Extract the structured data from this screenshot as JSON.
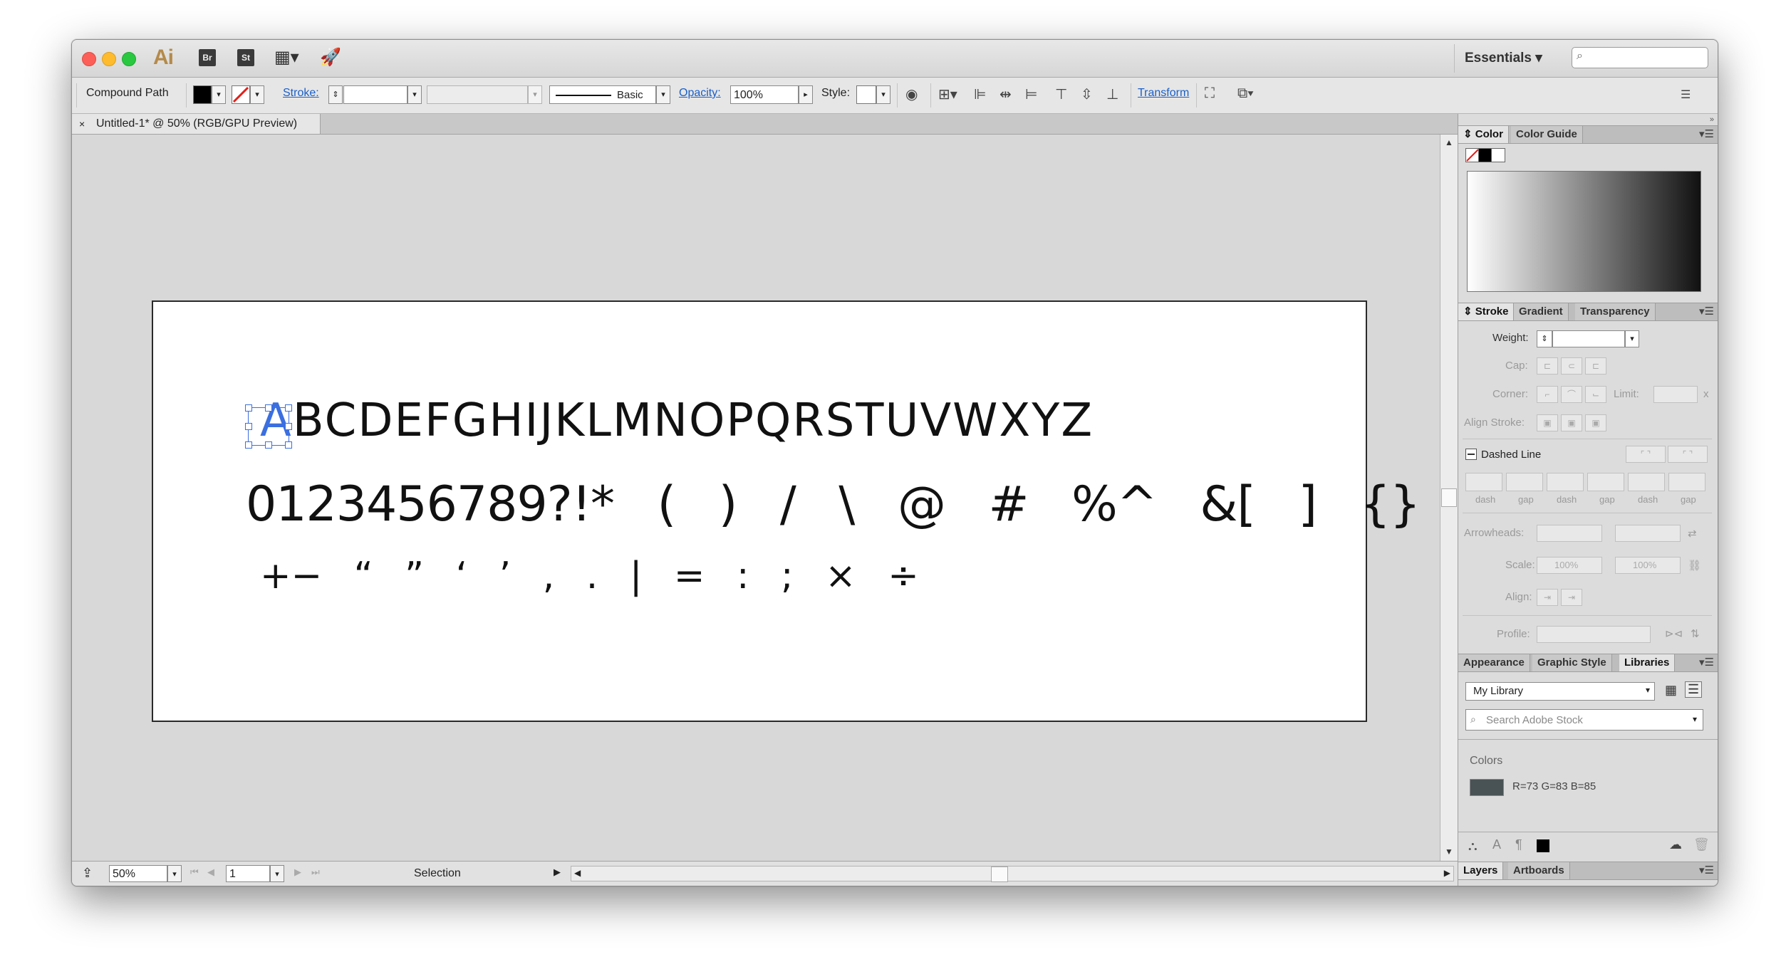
{
  "titlebar": {
    "app_logo": "Ai",
    "bridge_label": "Br",
    "stock_label": "St",
    "workspace": "Essentials ▾",
    "search_placeholder": "⌕"
  },
  "controlbar": {
    "selection_type": "Compound Path",
    "stroke_label": "Stroke:",
    "brush_label": "Basic",
    "opacity_label": "Opacity:",
    "opacity_value": "100%",
    "style_label": "Style:",
    "transform_label": "Transform"
  },
  "document": {
    "close_glyph": "×",
    "tab_title": "Untitled-1* @ 50% (RGB/GPU Preview)"
  },
  "artboard": {
    "row1_selected": "A",
    "row1_rest": "BCDEFGHIJKLMNOPQRSTUVWXYZ",
    "row2": "0123456789?!* ( ) / \\ @ # %^ &[ ] {}",
    "row3": "+− “ ” ‘ ’ , . | = : ; × ÷"
  },
  "statusbar": {
    "zoom": "50%",
    "artboard_number": "1",
    "tool": "Selection"
  },
  "panels": {
    "color": {
      "tabs": [
        "Color",
        "Color Guide"
      ]
    },
    "stroke": {
      "tabs": [
        "Stroke",
        "Gradient",
        "Transparency"
      ],
      "weight_label": "Weight:",
      "cap_label": "Cap:",
      "corner_label": "Corner:",
      "limit_label": "Limit:",
      "limit_suffix": "x",
      "align_label": "Align Stroke:",
      "dashed_label": "Dashed Line",
      "dash_labels": [
        "dash",
        "gap",
        "dash",
        "gap",
        "dash",
        "gap"
      ],
      "arrowheads_label": "Arrowheads:",
      "scale_label": "Scale:",
      "scale_value_1": "100%",
      "scale_value_2": "100%",
      "align2_label": "Align:",
      "profile_label": "Profile:"
    },
    "libraries": {
      "tabs": [
        "Appearance",
        "Graphic Style",
        "Libraries"
      ],
      "library_name": "My Library",
      "search_placeholder": "Search Adobe Stock",
      "colors_heading": "Colors",
      "color_swatch": "#495355",
      "color_value": "R=73 G=83 B=85"
    },
    "bottom": {
      "tabs": [
        "Layers",
        "Artboards"
      ]
    }
  },
  "colors": {
    "selection": "#3b6fe0",
    "link": "#1a5fc8"
  }
}
